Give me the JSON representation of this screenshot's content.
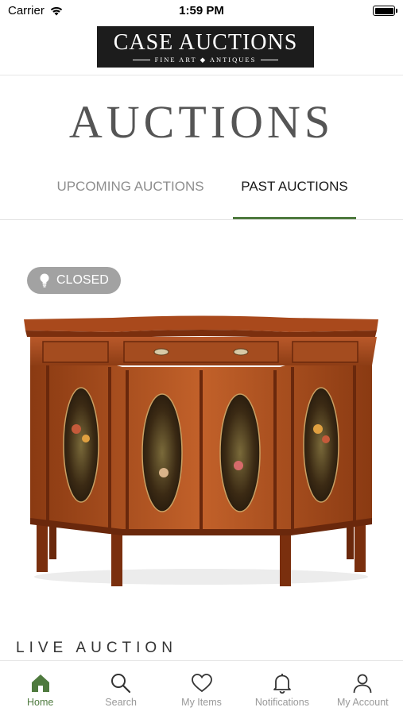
{
  "status_bar": {
    "carrier": "Carrier",
    "time": "1:59 PM"
  },
  "header": {
    "logo_main": "CASE AUCTIONS",
    "logo_sub": "FINE ART ◆ ANTIQUES"
  },
  "page": {
    "title": "AUCTIONS"
  },
  "tabs": [
    {
      "label": "UPCOMING AUCTIONS",
      "active": false
    },
    {
      "label": "PAST AUCTIONS",
      "active": true
    }
  ],
  "auction_card": {
    "badge": "CLOSED",
    "type_label": "LIVE AUCTION"
  },
  "tabbar": [
    {
      "label": "Home",
      "icon": "home-icon",
      "active": true
    },
    {
      "label": "Search",
      "icon": "search-icon",
      "active": false
    },
    {
      "label": "My Items",
      "icon": "heart-icon",
      "active": false
    },
    {
      "label": "Notifications",
      "icon": "bell-icon",
      "active": false
    },
    {
      "label": "My Account",
      "icon": "user-icon",
      "active": false
    }
  ],
  "colors": {
    "accent": "#4e7a3e",
    "badge_bg": "#a2a2a2",
    "inactive_tab": "#8e8e8e"
  }
}
